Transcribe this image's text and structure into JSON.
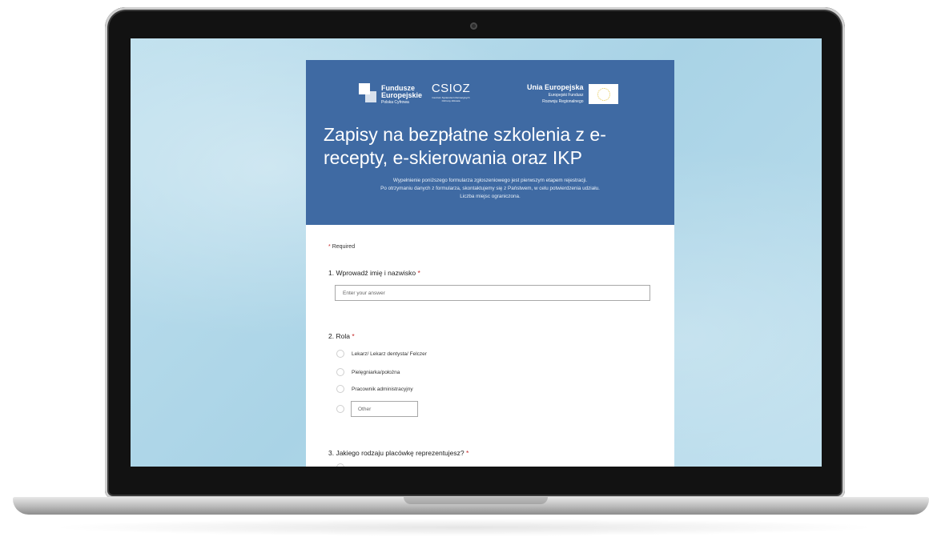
{
  "header": {
    "logos": {
      "fe_line1": "Fundusze",
      "fe_line2": "Europejskie",
      "fe_line3": "Polska Cyfrowa",
      "csioz": "CSIOZ",
      "csioz_sub": "Centrum Systemów Informacyjnych Ochrony Zdrowia",
      "ue_title": "Unia Europejska",
      "ue_line1": "Europejski Fundusz",
      "ue_line2": "Rozwoju Regionalnego"
    },
    "title": "Zapisy na bezpłatne szkolenia z e-recepty, e-skierowania oraz IKP",
    "description": [
      "Wypełnienie poniższego formularza zgłoszeniowego jest pierwszym etapem rejestracji.",
      "Po otrzymaniu danych z formularza, skontaktujemy się z Państwem, w celu potwierdzenia udziału.",
      "Liczba miejsc ograniczona."
    ],
    "background_color": "#3f6aa3"
  },
  "form": {
    "required_star": "*",
    "required_text": "Required",
    "questions": [
      {
        "label": "1. Wprowadź imię i nazwisko",
        "star": "*",
        "placeholder": "Enter your answer",
        "value": ""
      },
      {
        "label": "2. Rola",
        "star": "*",
        "options": [
          "Lekarz/ Lekarz dentysta/ Felczer",
          "Pielęgniarka/położna",
          "Pracownik administracyjny"
        ],
        "other_placeholder": "Other"
      },
      {
        "label": "3. Jakiego rodzaju placówkę reprezentujesz?",
        "star": "*"
      }
    ]
  },
  "icons": {
    "camera": "camera-dot-icon",
    "radio": "radio-circle-icon",
    "fe_logo": "fundusze-europejskie-logo",
    "eu_flag": "eu-flag-icon"
  }
}
